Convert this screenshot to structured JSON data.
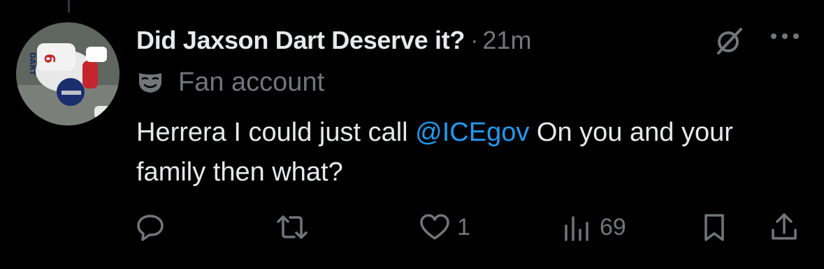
{
  "tweet": {
    "display_name": "Did Jaxson Dart Deserve it?",
    "separator": "·",
    "time": "21m",
    "label": "Fan account",
    "text_before": "Herrera I could just call ",
    "mention": "@ICEgov",
    "text_after": " On you and your family then what?"
  },
  "actions": {
    "reply_count": "",
    "retweet_count": "",
    "like_count": "1",
    "views_count": "69"
  },
  "icons": {
    "avatar": "avatar-football-player-image",
    "grok": "grok-icon",
    "more": "more-dots-icon",
    "label": "mask-icon",
    "reply": "reply-icon",
    "retweet": "retweet-icon",
    "like": "heart-icon",
    "views": "views-chart-icon",
    "bookmark": "bookmark-icon",
    "share": "share-icon"
  },
  "colors": {
    "background": "#000000",
    "text": "#e7e9ea",
    "secondary": "#71767b",
    "link": "#1d9bf0"
  }
}
